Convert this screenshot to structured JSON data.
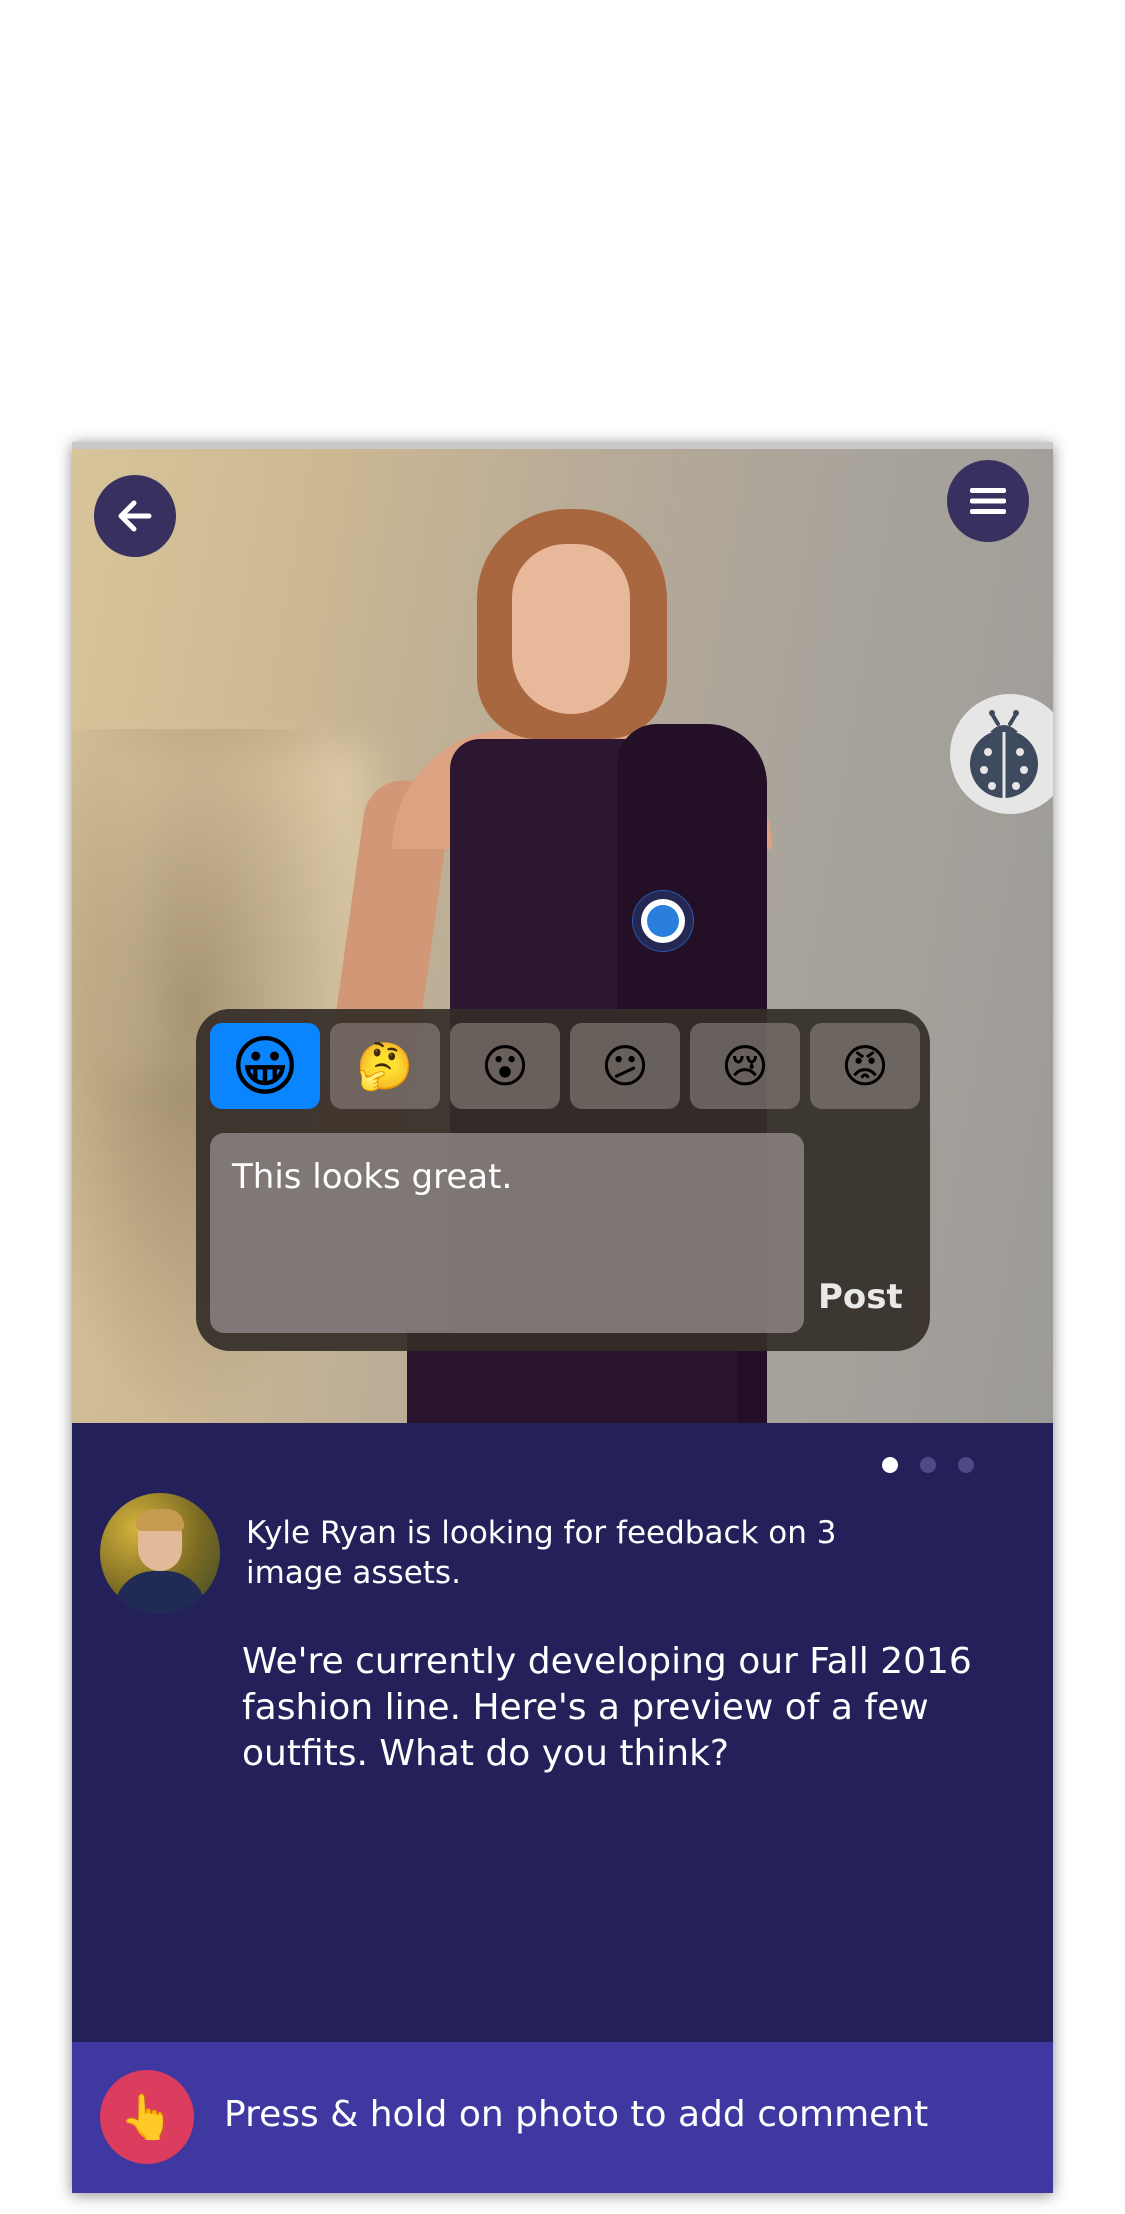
{
  "photo": {
    "back_icon": "arrow-left-icon",
    "menu_icon": "hamburger-menu-icon",
    "bug_icon": "ladybug-icon"
  },
  "comment": {
    "emojis": [
      "😀",
      "🤔",
      "😮",
      "😕",
      "😢",
      "😡"
    ],
    "selected_index": 0,
    "text": "This looks great.",
    "post_label": "Post"
  },
  "pager": {
    "count": 3,
    "active": 0
  },
  "feed": {
    "feedback_line": "Kyle Ryan is looking for feedback on 3 image assets.",
    "description": "We're currently developing our Fall 2016 fashion line. Here's a preview of a few outfits. What do you think?"
  },
  "bottom": {
    "hand_icon": "👆",
    "hint": "Press & hold on photo to add comment"
  },
  "colors": {
    "panel": "#23205a",
    "bottom_bar": "#3e38a0",
    "accent_blue": "#0a84ff",
    "hand_button": "#dc3d5e"
  }
}
